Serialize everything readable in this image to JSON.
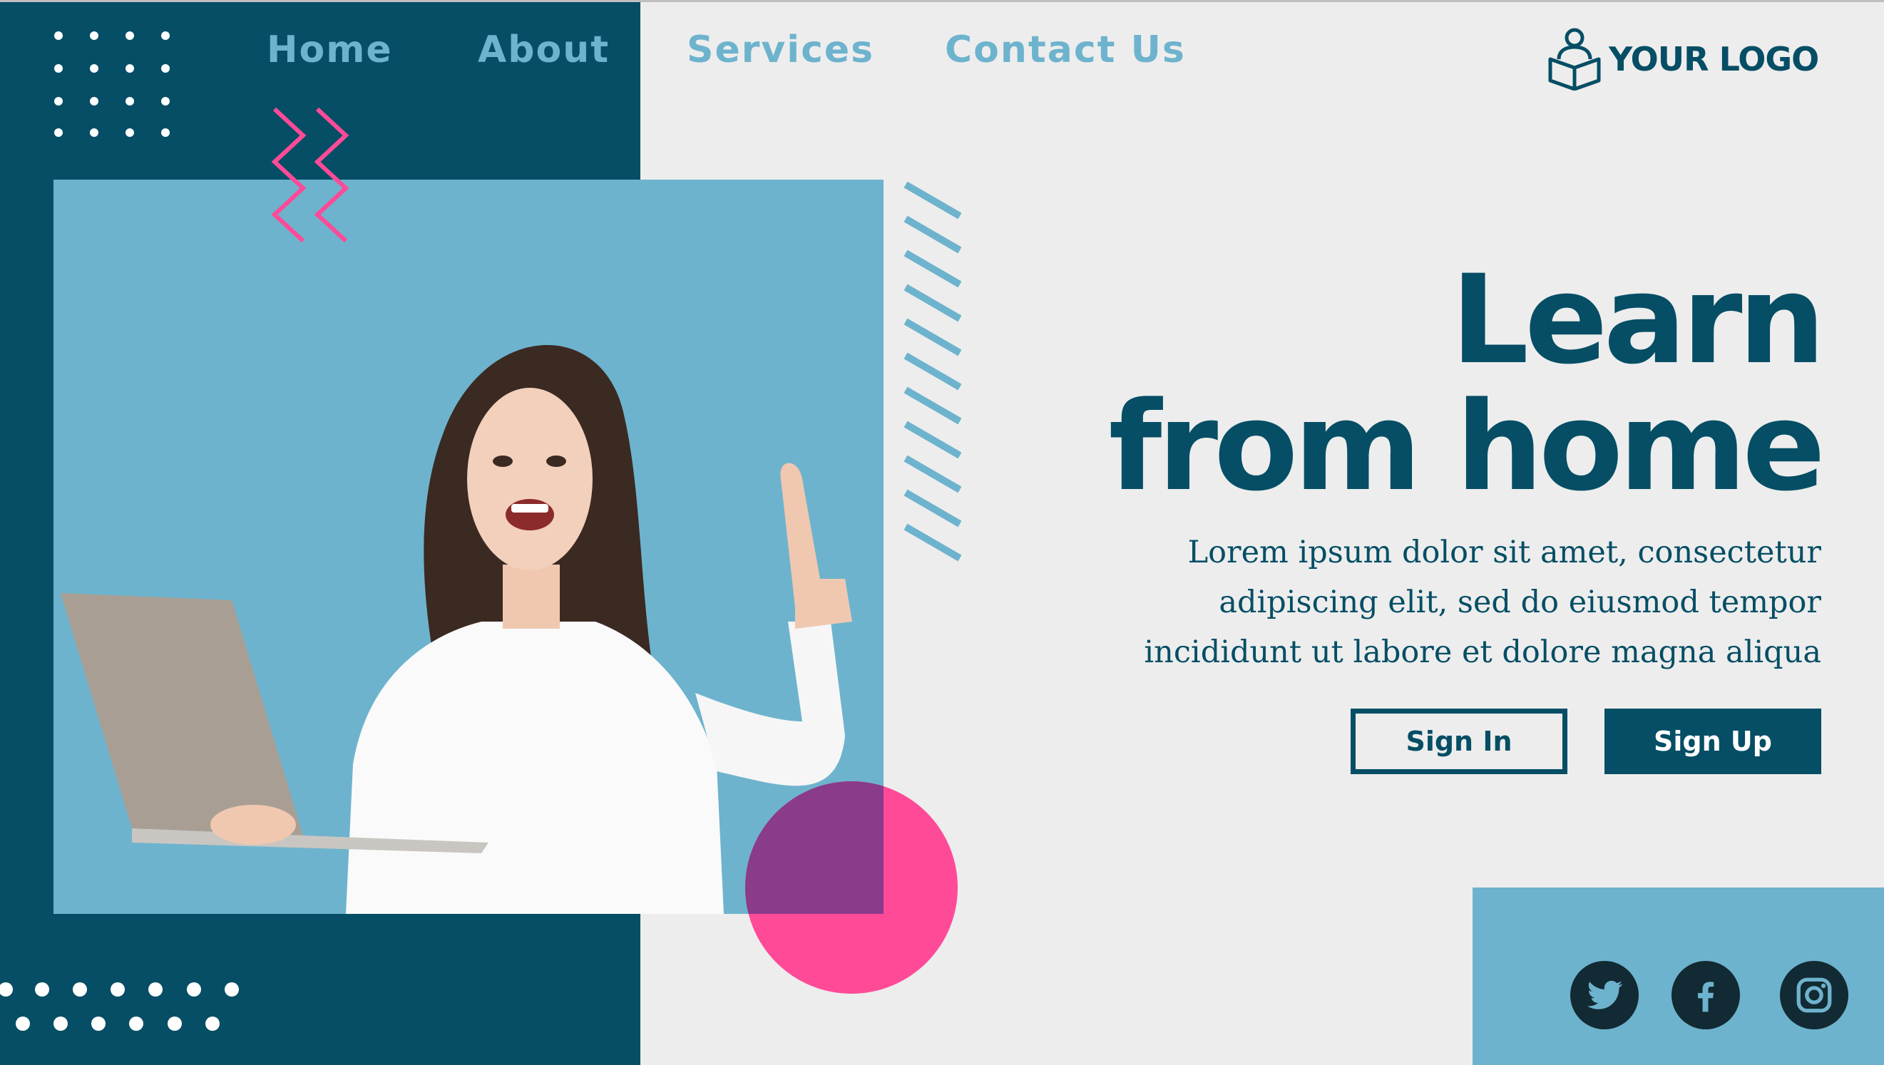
{
  "nav": {
    "items": [
      {
        "label": "Home"
      },
      {
        "label": "About"
      },
      {
        "label": "Services"
      },
      {
        "label": "Contact Us"
      }
    ]
  },
  "logo": {
    "text": "YOUR LOGO",
    "icon": "reader-icon"
  },
  "hero": {
    "headline_line1": "Learn",
    "headline_line2": "from home",
    "body_line1": "Lorem ipsum dolor sit amet, consectetur",
    "body_line2": "adipiscing elit, sed do eiusmod tempor",
    "body_line3": "incididunt ut labore et dolore magna aliqua",
    "image": "woman-with-laptop-photo"
  },
  "buttons": {
    "sign_in": "Sign In",
    "sign_up": "Sign Up"
  },
  "social": [
    "twitter-icon",
    "facebook-icon",
    "instagram-icon"
  ],
  "colors": {
    "primary": "#054e65",
    "light_blue": "#6eb3cd",
    "pink": "#ff4a98",
    "background": "#ededed"
  }
}
